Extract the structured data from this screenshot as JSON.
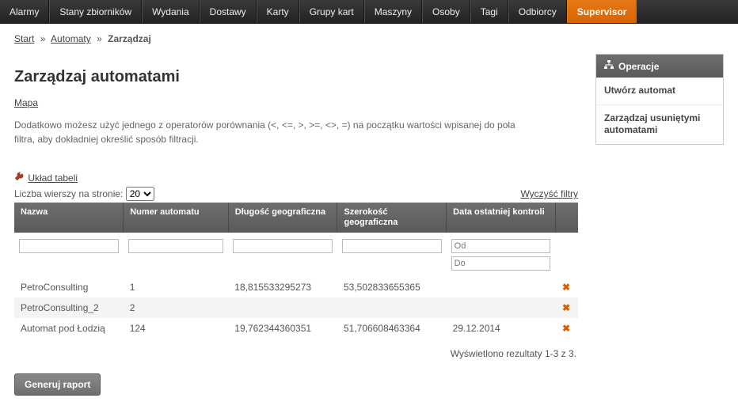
{
  "nav": {
    "items": [
      {
        "label": "Alarmy"
      },
      {
        "label": "Stany zbiorników"
      },
      {
        "label": "Wydania"
      },
      {
        "label": "Dostawy"
      },
      {
        "label": "Karty"
      },
      {
        "label": "Grupy kart"
      },
      {
        "label": "Maszyny"
      },
      {
        "label": "Osoby"
      },
      {
        "label": "Tagi"
      },
      {
        "label": "Odbiorcy"
      },
      {
        "label": "Supervisor",
        "active": true
      }
    ]
  },
  "breadcrumb": {
    "start": "Start",
    "seg1": "Automaty",
    "seg2": "Zarządzaj"
  },
  "page": {
    "title": "Zarządzaj automatami",
    "mapa": "Mapa",
    "description": "Dodatkowo możesz użyć jednego z operatorów porównania (<, <=, >, >=, <>, =) na początku wartości wpisanej do pola filtra, aby dokładniej określić sposób filtracji.",
    "layout_link": "Układ tabeli",
    "rows_label": "Liczba wierszy na stronie:",
    "rows_value": "20",
    "clear_filters": "Wyczyść filtry",
    "results_text": "Wyświetlono rezultaty 1-3 z 3.",
    "generate_btn": "Generuj raport"
  },
  "table": {
    "headers": {
      "name": "Nazwa",
      "number": "Numer automatu",
      "lon": "Długość geograficzna",
      "lat": "Szerokość geograficzna",
      "date": "Data ostatniej kontroli"
    },
    "filter_placeholders": {
      "date_from": "Od",
      "date_to": "Do"
    },
    "rows": [
      {
        "name": "PetroConsulting",
        "number": "1",
        "lon": "18,815533295273",
        "lat": "53,502833655365",
        "date": ""
      },
      {
        "name": "PetroConsulting_2",
        "number": "2",
        "lon": "",
        "lat": "",
        "date": ""
      },
      {
        "name": "Automat pod Łodzią",
        "number": "124",
        "lon": "19,762344360351",
        "lat": "51,706608463364",
        "date": "29.12.2014"
      }
    ]
  },
  "sidebar": {
    "title": "Operacje",
    "items": [
      {
        "label": "Utwórz automat"
      },
      {
        "label": "Zarządzaj usuniętymi automatami"
      }
    ]
  }
}
